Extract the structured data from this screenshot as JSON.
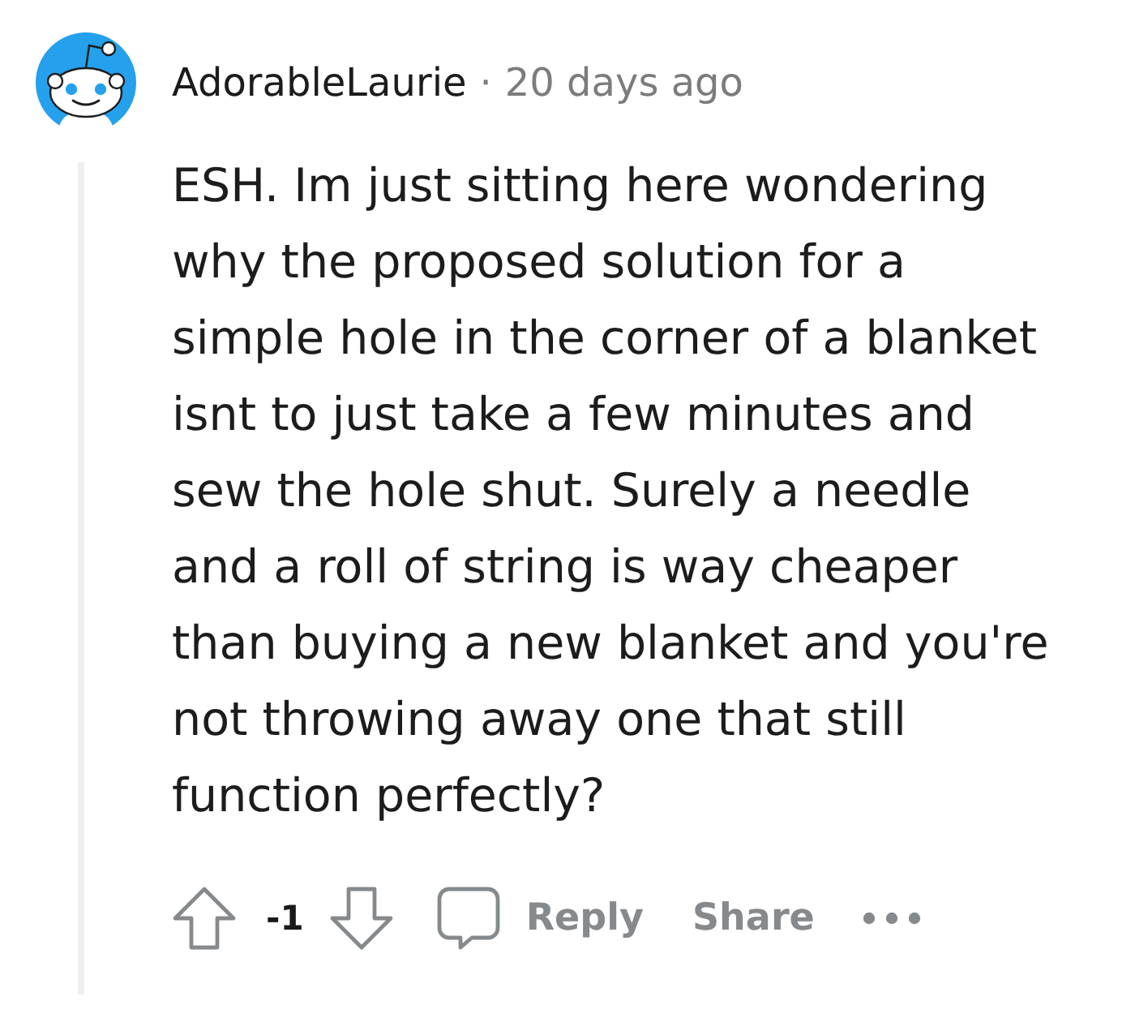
{
  "comment": {
    "author": "AdorableLaurie",
    "separator": "·",
    "time": "20 days ago",
    "body": "ESH. Im just sitting here wondering why the proposed solution for a simple hole in the corner of a blanket isnt to just take a few minutes and sew the hole shut. Surely a needle and a roll of string is way cheaper than buying a new blanket and you're not throwing away one that still function perfectly?",
    "score": "-1",
    "actions": [
      {
        "kind": "reply",
        "label": "Reply"
      },
      {
        "kind": "share",
        "label": "Share"
      }
    ]
  }
}
